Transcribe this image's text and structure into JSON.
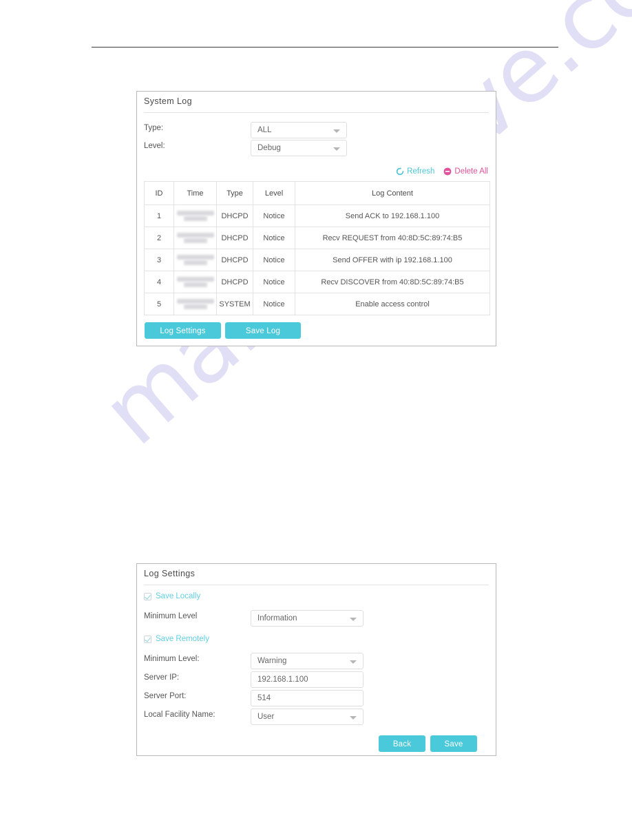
{
  "page": {
    "watermark": "manualshive.com"
  },
  "system_log": {
    "title": "System Log",
    "filters": [
      {
        "label": "Type:",
        "value": "ALL",
        "name": "type"
      },
      {
        "label": "Level:",
        "value": "Debug",
        "name": "level"
      }
    ],
    "actions": {
      "refresh": "Refresh",
      "delete_all": "Delete All",
      "refresh_icon": "refresh-circular-arrow-icon",
      "delete_icon": "delete-minus-circle-icon",
      "refresh_color": "#4fc6d8",
      "delete_color": "#e0539b"
    },
    "table": {
      "columns": [
        "ID",
        "Time",
        "Type",
        "Level",
        "Log Content"
      ],
      "rows": [
        {
          "id": "1",
          "time": "",
          "type": "DHCPD",
          "level": "Notice",
          "content": "Send ACK to 192.168.1.100"
        },
        {
          "id": "2",
          "time": "",
          "type": "DHCPD",
          "level": "Notice",
          "content": "Recv REQUEST from 40:8D:5C:89:74:B5"
        },
        {
          "id": "3",
          "time": "",
          "type": "DHCPD",
          "level": "Notice",
          "content": "Send OFFER with ip 192.168.1.100"
        },
        {
          "id": "4",
          "time": "",
          "type": "DHCPD",
          "level": "Notice",
          "content": "Recv DISCOVER from 40:8D:5C:89:74:B5"
        },
        {
          "id": "5",
          "time": "",
          "type": "SYSTEM",
          "level": "Notice",
          "content": "Enable access control"
        }
      ]
    },
    "buttons": {
      "log_settings": "Log Settings",
      "save_log": "Save Log"
    }
  },
  "log_settings": {
    "title": "Log Settings",
    "save_locally": {
      "label": "Save Locally",
      "checked": true,
      "minimum_level_label": "Minimum Level",
      "minimum_level_value": "Information"
    },
    "save_remotely": {
      "label": "Save Remotely",
      "checked": true,
      "fields": [
        {
          "label": "Minimum Level:",
          "value": "Warning",
          "control": "select",
          "name": "minimum-level-remote"
        },
        {
          "label": "Server IP:",
          "value": "192.168.1.100",
          "control": "text",
          "name": "server-ip"
        },
        {
          "label": "Server Port:",
          "value": "514",
          "control": "text",
          "name": "server-port"
        },
        {
          "label": "Local Facility Name:",
          "value": "User",
          "control": "select",
          "name": "local-facility-name"
        }
      ]
    },
    "buttons": {
      "back": "Back",
      "save": "Save"
    }
  },
  "theme": {
    "accent_teal": "#4ac9da",
    "link_pink": "#e0539b",
    "panel_border": "#b8b8b8"
  }
}
